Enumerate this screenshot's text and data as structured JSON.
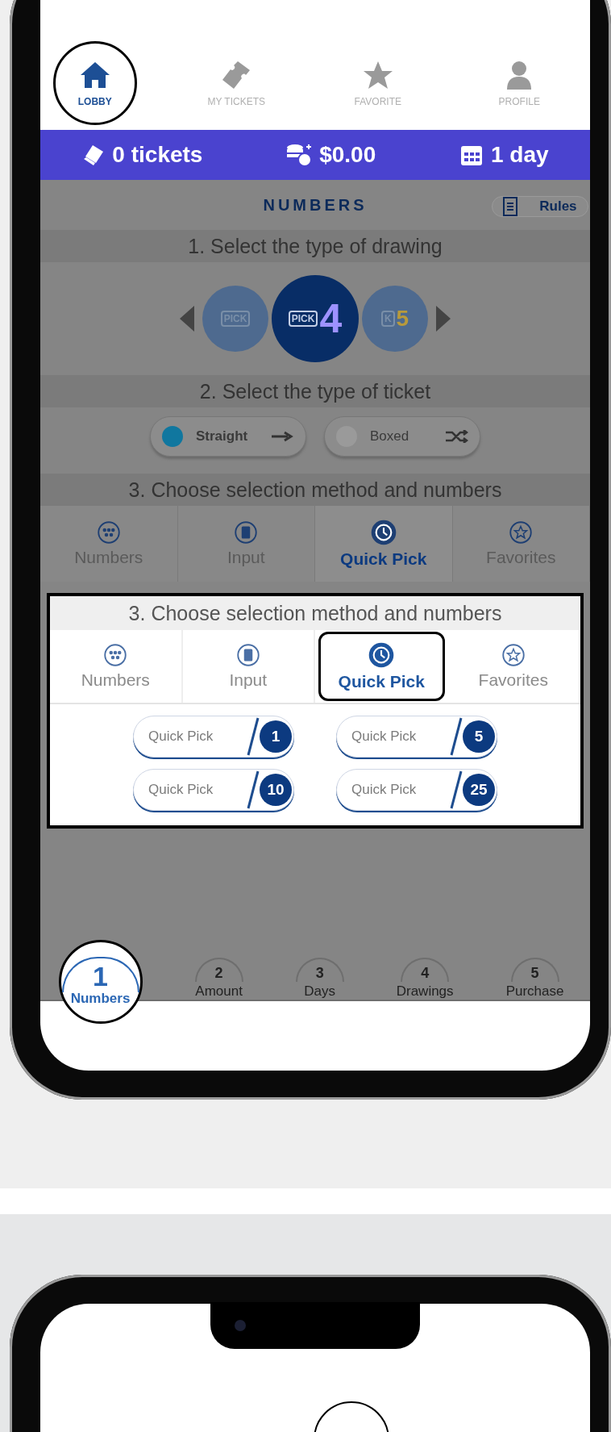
{
  "nav": [
    {
      "label": "LOBBY",
      "selected": true,
      "highlighted": true
    },
    {
      "label": "MY TICKETS",
      "selected": false,
      "highlighted": false
    },
    {
      "label": "FAVORITE",
      "selected": false,
      "highlighted": false
    },
    {
      "label": "PROFILE",
      "selected": false,
      "highlighted": false
    }
  ],
  "summary_bar": [
    {
      "text": "0 tickets"
    },
    {
      "text": "$0.00"
    },
    {
      "text": "1 day"
    }
  ],
  "page_title": "NUMBERS",
  "rules_button": "Rules",
  "step_drawing": {
    "heading": "1. Select the type of drawing",
    "games": [
      {
        "label": "PICK",
        "selected": false
      },
      {
        "label": "PICK",
        "number": "4",
        "selected": true
      },
      {
        "label": "K",
        "number": "5",
        "selected": false
      }
    ]
  },
  "step_ticket": {
    "heading": "2. Select the type of ticket",
    "types": [
      {
        "label": "Straight",
        "selected": true
      },
      {
        "label": "Boxed",
        "selected": false
      }
    ]
  },
  "step_method": {
    "heading": "3. Choose selection method and numbers",
    "tabs": [
      {
        "label": "Numbers",
        "selected": false
      },
      {
        "label": "Input",
        "selected": false
      },
      {
        "label": "Quick Pick",
        "selected": true
      },
      {
        "label": "Favorites",
        "selected": false
      }
    ]
  },
  "callout": {
    "heading": "3. Choose selection method and numbers",
    "tabs": [
      {
        "label": "Numbers",
        "selected": false,
        "highlighted": false
      },
      {
        "label": "Input",
        "selected": false,
        "highlighted": false
      },
      {
        "label": "Quick Pick",
        "selected": true,
        "highlighted": true
      },
      {
        "label": "Favorites",
        "selected": false,
        "highlighted": false
      }
    ],
    "quick_picks": [
      {
        "label": "Quick Pick",
        "count": "1"
      },
      {
        "label": "Quick Pick",
        "count": "5"
      },
      {
        "label": "Quick Pick",
        "count": "10"
      },
      {
        "label": "Quick Pick",
        "count": "25"
      }
    ]
  },
  "steps": [
    {
      "number": "1",
      "label": "Numbers",
      "selected": true,
      "highlighted": true
    },
    {
      "number": "2",
      "label": "Amount",
      "selected": false,
      "highlighted": false
    },
    {
      "number": "3",
      "label": "Days",
      "selected": false,
      "highlighted": false
    },
    {
      "number": "4",
      "label": "Drawings",
      "selected": false,
      "highlighted": false
    },
    {
      "number": "5",
      "label": "Purchase",
      "selected": false,
      "highlighted": false
    }
  ]
}
